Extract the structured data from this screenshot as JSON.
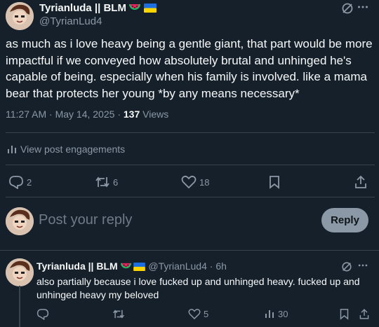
{
  "main_tweet": {
    "author_name": "Tyrianluda || BLM",
    "handle": "@TyrianLud4",
    "text_lines": [
      "as much as i love heavy being a gentle giant, that part would be more",
      "impactful if we conveyed how absolutely brutal and unhinged he's",
      "capable of being. especially when his family is involved. like a mama",
      "bear that protects her young *by any means necessary*"
    ],
    "time": "11:27 AM",
    "date": "May 14, 2025",
    "separator": "·",
    "views_count": "137",
    "views_label": "Views",
    "engagements_label": "View post engagements",
    "replies": "2",
    "reposts": "6",
    "likes": "18"
  },
  "reply_box": {
    "placeholder": "Post your reply",
    "button_label": "Reply"
  },
  "reply_tweet": {
    "author_name": "Tyrianluda || BLM",
    "handle": "@TyrianLud4",
    "separator": "·",
    "age": "6h",
    "text_lines": [
      "also partially because i love fucked up and unhinged heavy. fucked up and",
      "unhinged heavy my beloved"
    ],
    "likes": "5",
    "views": "30"
  },
  "icons": [
    "grok-icon",
    "more-icon",
    "analytics-icon",
    "reply-icon",
    "repost-icon",
    "like-icon",
    "bookmark-icon",
    "share-icon",
    "views-icon",
    "watermelon-icon",
    "ukraine-flag-icon"
  ],
  "colors": {
    "background": "#15202b",
    "text": "#f7f9f9",
    "muted": "#8b98a5",
    "divider": "#38444d"
  }
}
